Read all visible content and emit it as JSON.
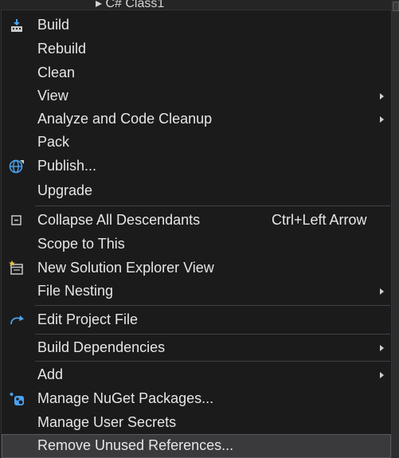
{
  "background": {
    "peek_text": "▸ C# Class1"
  },
  "menu": {
    "items": [
      {
        "label": "Build",
        "icon": "build-icon"
      },
      {
        "label": "Rebuild"
      },
      {
        "label": "Clean"
      },
      {
        "label": "View",
        "submenu": true
      },
      {
        "label": "Analyze and Code Cleanup",
        "submenu": true
      },
      {
        "label": "Pack"
      },
      {
        "label": "Publish...",
        "icon": "globe-icon"
      },
      {
        "label": "Upgrade"
      },
      {
        "label": "Collapse All Descendants",
        "shortcut": "Ctrl+Left Arrow",
        "icon": "collapse-icon"
      },
      {
        "label": "Scope to This"
      },
      {
        "label": "New Solution Explorer View",
        "icon": "new-window-icon"
      },
      {
        "label": "File Nesting",
        "submenu": true
      },
      {
        "label": "Edit Project File",
        "icon": "redo-arrow-icon"
      },
      {
        "label": "Build Dependencies",
        "submenu": true
      },
      {
        "label": "Add",
        "submenu": true
      },
      {
        "label": "Manage NuGet Packages...",
        "icon": "nuget-icon"
      },
      {
        "label": "Manage User Secrets"
      },
      {
        "label": "Remove Unused References...",
        "highlighted": true
      }
    ]
  },
  "colors": {
    "menu_bg": "#1b1b1c",
    "text": "#e6e6e6",
    "separator": "#3f3f46",
    "highlight": "#3a3a3d",
    "icon_blue": "#4aa3f0"
  }
}
